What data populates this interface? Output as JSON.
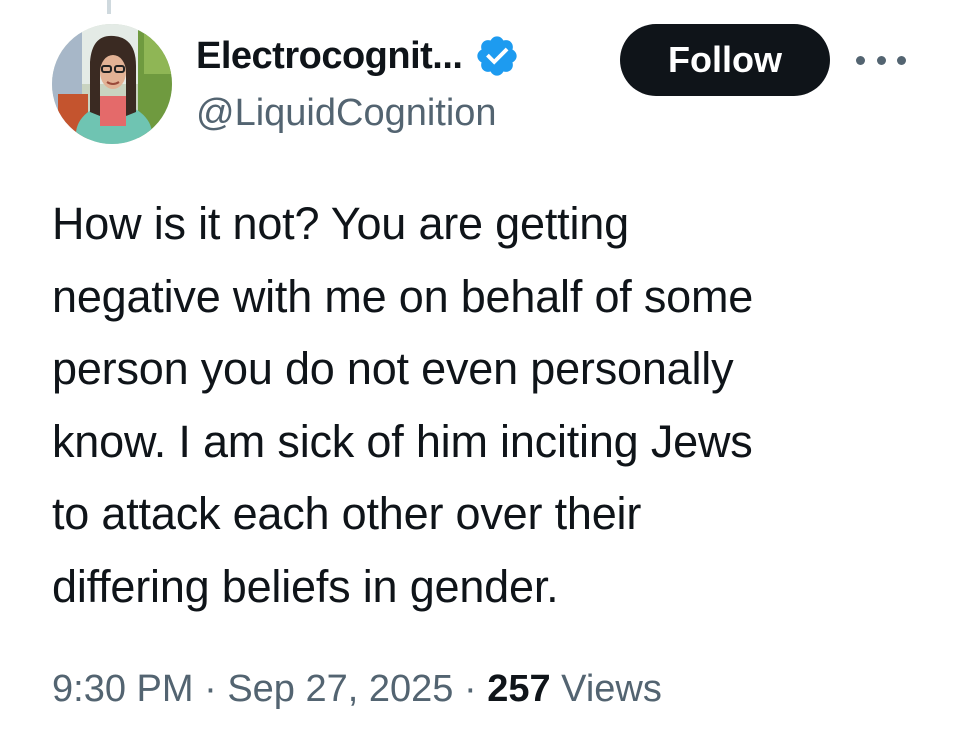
{
  "author": {
    "display_name": "Electrocognit...",
    "handle": "@LiquidCognition",
    "verified_icon": "verified-badge-icon",
    "avatar_icon": "profile-photo"
  },
  "actions": {
    "follow_label": "Follow",
    "more_icon": "more-horizontal-icon"
  },
  "tweet": {
    "lines": [
      "How is it not? You are getting",
      "negative with me on behalf of some",
      "person you do not even personally",
      "know. I am sick of him inciting Jews",
      "to attack each other over their",
      "differing beliefs in gender."
    ]
  },
  "meta": {
    "time": "9:30 PM",
    "separator": "·",
    "date": "Sep 27, 2025",
    "views_count": "257",
    "views_label": "Views"
  },
  "colors": {
    "text": "#0f1419",
    "secondary": "#536471",
    "verified": "#1d9bf0",
    "follow_bg": "#0f1419",
    "thread_line": "#cfd9de"
  }
}
